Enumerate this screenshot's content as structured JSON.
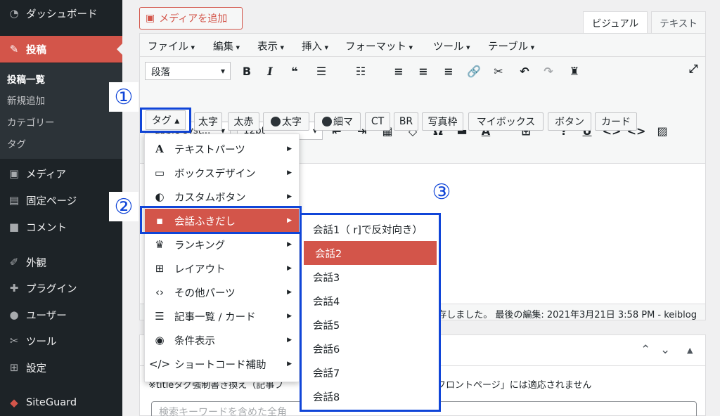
{
  "sidebar": {
    "items": [
      {
        "label": "ダッシュボード",
        "icon": "dashboard-icon"
      },
      {
        "label": "投稿",
        "icon": "pin-icon"
      },
      {
        "label": "メディア",
        "icon": "media-icon"
      },
      {
        "label": "固定ページ",
        "icon": "page-icon"
      },
      {
        "label": "コメント",
        "icon": "comment-icon"
      },
      {
        "label": "外観",
        "icon": "appearance-icon"
      },
      {
        "label": "プラグイン",
        "icon": "plugin-icon"
      },
      {
        "label": "ユーザー",
        "icon": "user-icon"
      },
      {
        "label": "ツール",
        "icon": "wrench-icon"
      },
      {
        "label": "設定",
        "icon": "settings-icon"
      },
      {
        "label": "SiteGuard",
        "icon": "siteguard-icon"
      }
    ],
    "submenu": [
      "投稿一覧",
      "新規追加",
      "カテゴリー",
      "タグ"
    ]
  },
  "toolbar": {
    "add_media": "メディアを追加",
    "tab_visual": "ビジュアル",
    "tab_text": "テキスト"
  },
  "menubar": [
    "ファイル",
    "編集",
    "表示",
    "挿入",
    "フォーマット",
    "ツール",
    "テーブル"
  ],
  "format": {
    "paragraph": "段落",
    "font": "-apple-syst...",
    "size": "12pt"
  },
  "quicktags": {
    "tag": "タグ",
    "buttons": [
      "太字",
      "太赤",
      "太字",
      "細マ",
      "CT",
      "BR",
      "写真枠",
      "マイボックス",
      "ボタン",
      "カード"
    ]
  },
  "annotations": {
    "one": "①",
    "two": "②",
    "three": "③"
  },
  "tag_menu": [
    {
      "label": "テキストパーツ",
      "icon": "text-icon"
    },
    {
      "label": "ボックスデザイン",
      "icon": "box-icon"
    },
    {
      "label": "カスタムボタン",
      "icon": "toggle-icon"
    },
    {
      "label": "会話ふきだし",
      "icon": "chat-icon"
    },
    {
      "label": "ランキング",
      "icon": "crown-icon"
    },
    {
      "label": "レイアウト",
      "icon": "grid-icon"
    },
    {
      "label": "その他パーツ",
      "icon": "code-icon"
    },
    {
      "label": "記事一覧 / カード",
      "icon": "list-icon"
    },
    {
      "label": "条件表示",
      "icon": "eye-icon"
    },
    {
      "label": "ショートコード補助",
      "icon": "shortcode-icon"
    }
  ],
  "chat_menu": [
    "会話1（ r]で反対向き）",
    "会話2",
    "会話3",
    "会話4",
    "会話5",
    "会話6",
    "会話7",
    "会話8"
  ],
  "status": {
    "text": "存しました。 最後の編集: 2021年3月21日 3:58 PM - keiblog"
  },
  "panel": {
    "note": "※titleタグ強制書き換え（記事ブ",
    "note2": "フロントページ」には適応されません",
    "search_placeholder": "検索キーワードを含めた全角"
  },
  "colors": {
    "accent": "#d3554a",
    "highlight": "#1045d8",
    "sidebar": "#1d2327"
  }
}
